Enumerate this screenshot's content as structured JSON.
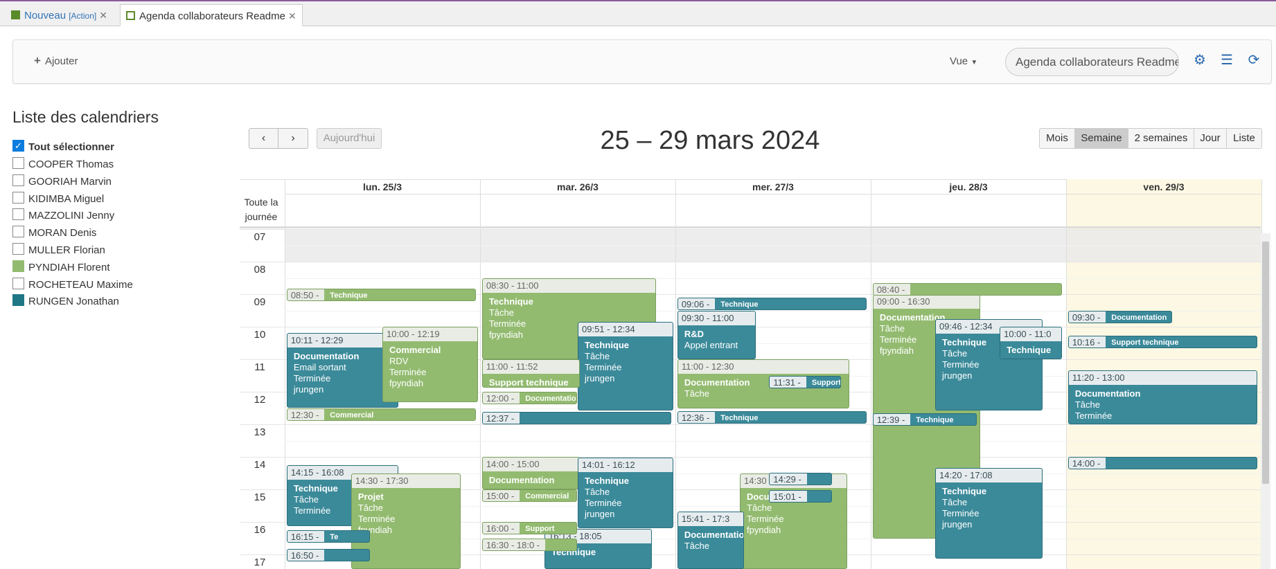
{
  "tabs": [
    {
      "label": "Nouveau",
      "suffix": "[Action]",
      "color": "#5a8a2a"
    },
    {
      "label": "Agenda collaborateurs Readme",
      "color": "#5a8a2a"
    }
  ],
  "toolbar": {
    "add_label": "Ajouter",
    "view_label": "Vue",
    "search_value": "Agenda collaborateurs Readme"
  },
  "sidebar": {
    "title": "Liste des calendriers",
    "select_all": "Tout sélectionner",
    "calendars": [
      {
        "label": "COOPER Thomas",
        "state": "unchecked"
      },
      {
        "label": "GOORIAH Marvin",
        "state": "unchecked"
      },
      {
        "label": "KIDIMBA Miguel",
        "state": "unchecked"
      },
      {
        "label": "MAZZOLINI Jenny",
        "state": "unchecked"
      },
      {
        "label": "MORAN Denis",
        "state": "unchecked"
      },
      {
        "label": "MULLER Florian",
        "state": "unchecked"
      },
      {
        "label": "PYNDIAH Florent",
        "state": "filled",
        "color": "#93bb70"
      },
      {
        "label": "ROCHETEAU Maxime",
        "state": "unchecked"
      },
      {
        "label": "RUNGEN Jonathan",
        "state": "filled",
        "color": "#1f7785"
      }
    ]
  },
  "nav": {
    "prev": "‹",
    "next": "›",
    "today": "Aujourd'hui",
    "range": "25 – 29 mars 2024"
  },
  "views": [
    "Mois",
    "Semaine",
    "2 semaines",
    "Jour",
    "Liste"
  ],
  "active_view": "Semaine",
  "days": [
    "lun. 25/3",
    "mar. 26/3",
    "mer. 27/3",
    "jeu. 28/3",
    "ven. 29/3"
  ],
  "allday_label": "Toute la journée",
  "hours": [
    "07",
    "08",
    "09",
    "10",
    "11",
    "12",
    "13",
    "14",
    "15",
    "16",
    "17"
  ],
  "events": [
    {
      "day": 0,
      "start": "10:11",
      "end": "12:29",
      "head": "10:11 - 12:29",
      "title": "Documentation",
      "lines": [
        "Email sortant",
        "Terminée",
        "jrungen"
      ],
      "color": "t"
    },
    {
      "day": 0,
      "start": "10:00",
      "end": "12:19",
      "head": "10:00 - 12:19",
      "title": "Commercial",
      "lines": [
        "RDV",
        "Terminée",
        "fpyndiah"
      ],
      "color": "g"
    },
    {
      "day": 0,
      "start": "14:15",
      "end": "16:08",
      "head": "14:15 - 16:08",
      "title": "Technique",
      "lines": [
        "Tâche",
        "Terminée"
      ],
      "color": "t"
    },
    {
      "day": 0,
      "start": "14:30",
      "end": "17:30",
      "head": "14:30 - 17:30",
      "title": "Projet",
      "lines": [
        "Tâche",
        "Terminée",
        "fpyndiah"
      ],
      "color": "g"
    },
    {
      "day": 1,
      "start": "08:30",
      "end": "11:00",
      "head": "08:30 - 11:00",
      "title": "Technique",
      "lines": [
        "Tâche",
        "Terminée",
        "fpyndiah"
      ],
      "color": "g"
    },
    {
      "day": 1,
      "start": "09:51",
      "end": "12:34",
      "head": "09:51 - 12:34",
      "title": "Technique",
      "lines": [
        "Tâche",
        "Terminée",
        "jrungen"
      ],
      "color": "t"
    },
    {
      "day": 1,
      "start": "11:00",
      "end": "11:52",
      "head": "11:00 - 11:52",
      "title": "Support technique",
      "lines": [],
      "color": "g"
    },
    {
      "day": 1,
      "start": "14:00",
      "end": "15:00",
      "head": "14:00 - 15:00",
      "title": "Documentation",
      "lines": [],
      "color": "g"
    },
    {
      "day": 1,
      "start": "14:01",
      "end": "16:12",
      "head": "14:01 - 16:12",
      "title": "Technique",
      "lines": [
        "Tâche",
        "Terminée",
        "jrungen"
      ],
      "color": "t"
    },
    {
      "day": 1,
      "start": "16:13",
      "end": "18:05",
      "head": "16:13 - 18:05",
      "title": "Technique",
      "lines": [],
      "color": "t"
    },
    {
      "day": 2,
      "start": "09:30",
      "end": "11:00",
      "head": "09:30 - 11:00",
      "title": "R&D",
      "lines": [
        "Appel entrant"
      ],
      "color": "t"
    },
    {
      "day": 2,
      "start": "11:00",
      "end": "12:30",
      "head": "11:00 - 12:30",
      "title": "Documentation",
      "lines": [
        "Tâche"
      ],
      "color": "g"
    },
    {
      "day": 2,
      "start": "14:30",
      "end": "17:30",
      "head": "14:30 - 17:30",
      "title": "Documentation",
      "lines": [
        "Tâche",
        "Terminée",
        "fpyndiah"
      ],
      "color": "g"
    },
    {
      "day": 2,
      "start": "15:41",
      "end": "17:30",
      "head": "15:41 - 17:3",
      "title": "Documentation",
      "lines": [
        "Tâche"
      ],
      "color": "t"
    },
    {
      "day": 3,
      "start": "09:00",
      "end": "16:30",
      "head": "09:00 - 16:30",
      "title": "Documentation",
      "lines": [
        "Tâche",
        "Terminée",
        "fpyndiah"
      ],
      "color": "g"
    },
    {
      "day": 3,
      "start": "09:46",
      "end": "12:34",
      "head": "09:46 - 12:34",
      "title": "Technique",
      "lines": [
        "Tâche",
        "Terminée",
        "jrungen"
      ],
      "color": "t"
    },
    {
      "day": 3,
      "start": "10:00",
      "end": "11:00",
      "head": "10:00 - 11:0",
      "title": "Technique",
      "lines": [],
      "color": "t"
    },
    {
      "day": 3,
      "start": "14:20",
      "end": "17:08",
      "head": "14:20 - 17:08",
      "title": "Technique",
      "lines": [
        "Tâche",
        "Terminée",
        "jrungen"
      ],
      "color": "t"
    },
    {
      "day": 4,
      "start": "11:20",
      "end": "13:00",
      "head": "11:20 - 13:00",
      "title": "Documentation",
      "lines": [
        "Tâche",
        "Terminée"
      ],
      "color": "t"
    }
  ],
  "small_events": [
    {
      "day": 0,
      "top": "08:50",
      "head": "08:50",
      "label": "Technique",
      "color": "g",
      "w": 1
    },
    {
      "day": 0,
      "top": "12:30",
      "head": "12:30",
      "label": "Commercial",
      "color": "g",
      "w": 1
    },
    {
      "day": 0,
      "top": "16:15",
      "head": "16:15",
      "label": "Te",
      "color": "t",
      "w": 0.44
    },
    {
      "day": 0,
      "top": "16:50",
      "head": "16:50",
      "label": "",
      "color": "t",
      "w": 0.44
    },
    {
      "day": 1,
      "top": "12:00",
      "head": "12:00",
      "label": "Documentation",
      "color": "g",
      "w": 0.5
    },
    {
      "day": 1,
      "top": "12:37",
      "head": "12:37",
      "label": "",
      "color": "t",
      "w": 1
    },
    {
      "day": 1,
      "top": "15:00",
      "head": "15:00",
      "label": "Commercial",
      "color": "g",
      "w": 0.5
    },
    {
      "day": 1,
      "top": "16:00",
      "head": "16:00",
      "label": "Support",
      "color": "g",
      "w": 0.5
    },
    {
      "day": 1,
      "top": "16:30",
      "head": "16:30 - 18:0",
      "label": "",
      "color": "g",
      "w": 0.5
    },
    {
      "day": 2,
      "top": "09:06",
      "head": "09:06",
      "label": "Technique",
      "color": "t",
      "w": 1
    },
    {
      "day": 2,
      "top": "12:36",
      "head": "12:36",
      "label": "Technique",
      "color": "t",
      "w": 1
    },
    {
      "day": 2,
      "top": "11:31",
      "head": "11:31",
      "label": "Support technique",
      "color": "t",
      "w": 0.38
    },
    {
      "day": 2,
      "top": "14:29",
      "head": "14:29",
      "label": "",
      "color": "t",
      "w": 0.33
    },
    {
      "day": 2,
      "top": "15:01",
      "head": "15:01",
      "label": "",
      "color": "t",
      "w": 0.33
    },
    {
      "day": 3,
      "top": "08:40",
      "head": "08:40",
      "label": "",
      "color": "g",
      "w": 1
    },
    {
      "day": 3,
      "top": "12:39",
      "head": "12:39",
      "label": "Technique",
      "color": "t",
      "w": 0.55
    },
    {
      "day": 4,
      "top": "09:30",
      "head": "09:30",
      "label": "Documentation",
      "color": "t",
      "w": 0.55
    },
    {
      "day": 4,
      "top": "10:16",
      "head": "10:16",
      "label": "Support technique",
      "color": "t",
      "w": 1
    },
    {
      "day": 4,
      "top": "14:00",
      "head": "14:00",
      "label": "",
      "color": "t",
      "w": 1
    }
  ]
}
